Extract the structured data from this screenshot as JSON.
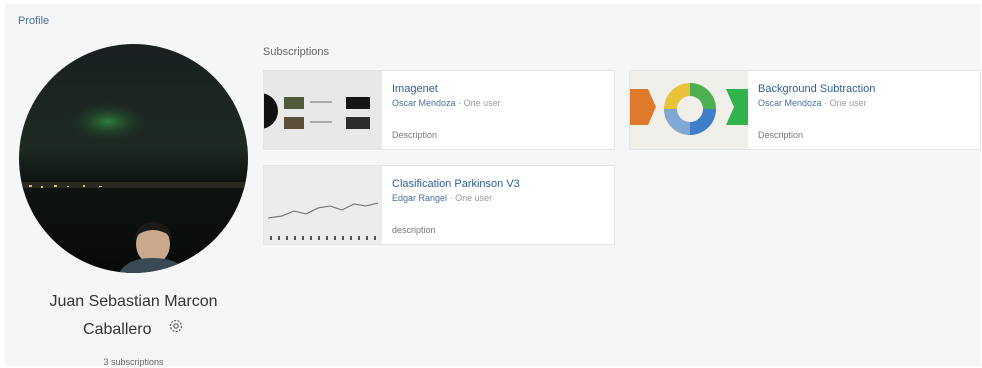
{
  "profile": {
    "header": "Profile",
    "name_line1": "Juan Sebastian Marcon",
    "name_line2": "Caballero",
    "subscriptions_count": "3 subscriptions"
  },
  "subscriptions": {
    "title": "Subscriptions",
    "cards": [
      {
        "title": "Imagenet",
        "author": "Oscar Mendoza",
        "separator": "·",
        "users": "One user",
        "description": "Description"
      },
      {
        "title": "Background Subtraction",
        "author": "Oscar Mendoza",
        "separator": "·",
        "users": "One user",
        "description": "Description"
      },
      {
        "title": "Clasification Parkinson V3",
        "author": "Edgar Rangel",
        "separator": "·",
        "users": "One user",
        "description": "description"
      }
    ]
  },
  "icons": {
    "settings": "gear-icon"
  },
  "colors": {
    "accent": "#2f5f93",
    "panel": "#f5f6f7"
  }
}
